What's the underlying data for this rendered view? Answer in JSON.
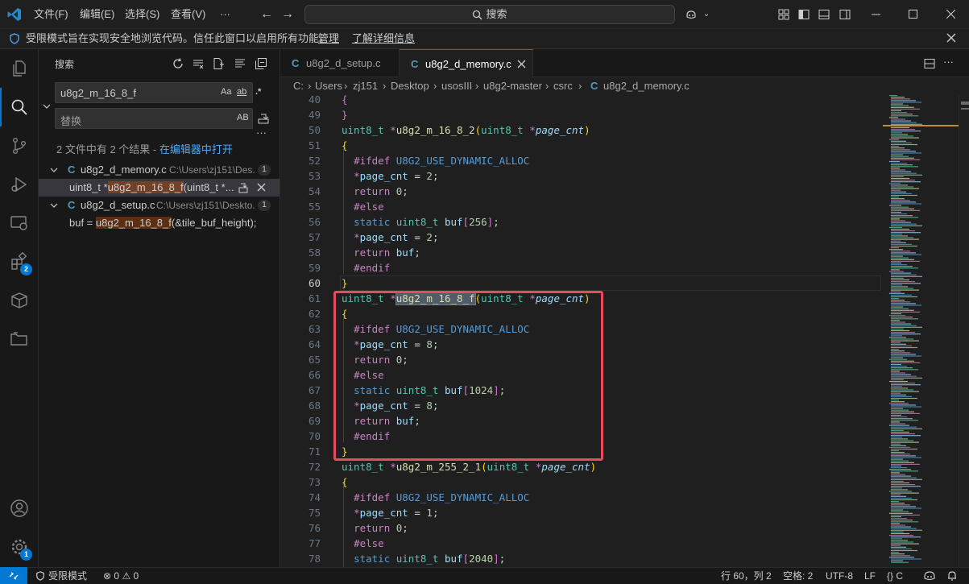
{
  "titlebar": {
    "menus": [
      "文件(F)",
      "编辑(E)",
      "选择(S)",
      "查看(V)",
      "···"
    ],
    "search": "搜索"
  },
  "banner": {
    "text": "受限模式旨在实现安全地浏览代码。信任此窗口以启用所有功能。",
    "manage": "管理",
    "learn_more": "了解详细信息"
  },
  "activity": {
    "extensions_badge": "2",
    "settings_badge": "1"
  },
  "sidebar": {
    "title": "搜索",
    "search_value": "u8g2_m_16_8_f",
    "search_opts": [
      "Aa",
      "ab",
      ".*"
    ],
    "replace_placeholder": "替换",
    "replace_opt": "AB",
    "summary": "2 文件中有 2 个结果 - ",
    "summary_link": "在编辑器中打开",
    "results": [
      {
        "file": "u8g2_d_memory.c",
        "path": "C:\\Users\\zj151\\Des...",
        "count": "1",
        "match_pre": "uint8_t *",
        "match_hl": "u8g2_m_16_8_f",
        "match_post": "(uint8_t *..."
      },
      {
        "file": "u8g2_d_setup.c",
        "path": "C:\\Users\\zj151\\Deskto...",
        "count": "1",
        "match_pre": "buf = ",
        "match_hl": "u8g2_m_16_8_f",
        "match_post": "(&tile_buf_height);"
      }
    ]
  },
  "tabs": [
    {
      "label": "u8g2_d_setup.c",
      "active": false
    },
    {
      "label": "u8g2_d_memory.c",
      "active": true
    }
  ],
  "breadcrumb": [
    "C:",
    "Users",
    "zj151",
    "Desktop",
    "usosIII",
    "u8g2-master",
    "csrc",
    "u8g2_d_memory.c"
  ],
  "editor": {
    "line_numbers": [
      "40",
      "49",
      "50",
      "51",
      "52",
      "53",
      "54",
      "55",
      "56",
      "57",
      "58",
      "59",
      "60",
      "61",
      "62",
      "63",
      "64",
      "65",
      "66",
      "67",
      "68",
      "69",
      "70",
      "71",
      "72",
      "73",
      "74",
      "75",
      "76",
      "77",
      "78"
    ],
    "current_line": "60"
  },
  "statusbar": {
    "restricted": "受限模式",
    "errors": "0",
    "warnings": "0",
    "position": "行 60，列 2",
    "spaces": "空格: 2",
    "encoding": "UTF-8",
    "eol": "LF",
    "language": "C"
  },
  "colors": {
    "accent": "#0078d4",
    "highlight_box": "#e84a5f"
  }
}
